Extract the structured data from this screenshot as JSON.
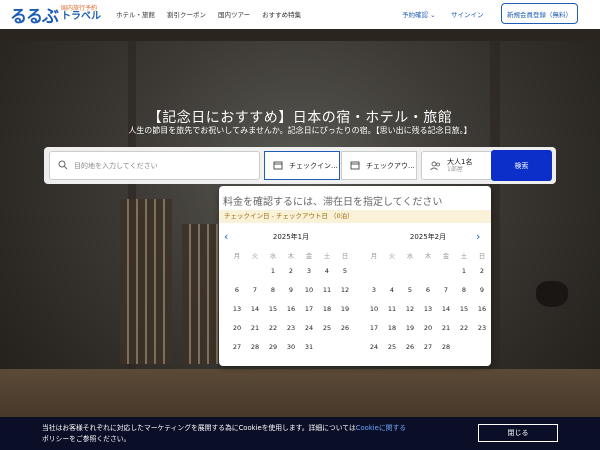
{
  "header": {
    "logo_main": "るるぶ",
    "logo_sub": "国内旅行予約",
    "logo_travel": "トラベル",
    "nav": [
      "ホテル・旅館",
      "割引クーポン",
      "国内ツアー",
      "おすすめ特集"
    ],
    "reservation_check": "予約確認",
    "sign_in": "サインイン",
    "register": "新規会員登録（無料）"
  },
  "hero": {
    "title": "【記念日におすすめ】日本の宿・ホテル・旅館",
    "subtitle": "人生の節目を旅先でお祝いしてみませんか。記念日にぴったりの宿。【思い出に残る記念日旅。】"
  },
  "search": {
    "destination_placeholder": "目的地を入力してください",
    "checkin_label": "チェックイン...",
    "checkout_label": "チェックアウ...",
    "guests_main": "大人1名",
    "guests_sub": "1部屋",
    "search_button": "検索"
  },
  "calendar": {
    "prompt": "料金を確認するには、滞在日を指定してください",
    "note": "チェックイン日 - チェックアウト日 （0泊）",
    "weekdays": [
      "月",
      "火",
      "水",
      "木",
      "金",
      "土",
      "日"
    ],
    "months": [
      {
        "title": "2025年1月",
        "days": [
          "",
          "",
          "1",
          "2",
          "3",
          "4",
          "5",
          "6",
          "7",
          "8",
          "9",
          "10",
          "11",
          "12",
          "13",
          "14",
          "15",
          "16",
          "17",
          "18",
          "19",
          "20",
          "21",
          "22",
          "23",
          "24",
          "25",
          "26",
          "27",
          "28",
          "29",
          "30",
          "31",
          "",
          ""
        ]
      },
      {
        "title": "2025年2月",
        "days": [
          "",
          "",
          "",
          "",
          "",
          "1",
          "2",
          "3",
          "4",
          "5",
          "6",
          "7",
          "8",
          "9",
          "10",
          "11",
          "12",
          "13",
          "14",
          "15",
          "16",
          "17",
          "18",
          "19",
          "20",
          "21",
          "22",
          "23",
          "24",
          "25",
          "26",
          "27",
          "28",
          "",
          ""
        ]
      }
    ]
  },
  "cookie": {
    "text_before": "当社はお客様それぞれに対応したマーケティングを展開する為にCookieを使用します。詳細については",
    "link": "Cookieに関する",
    "text_after": "ポリシーをご参照ください。",
    "close": "閉じる"
  },
  "colors": {
    "brand": "#1d5db5",
    "search_button": "#0b2fc8",
    "note_bg": "#f9f1d8"
  }
}
